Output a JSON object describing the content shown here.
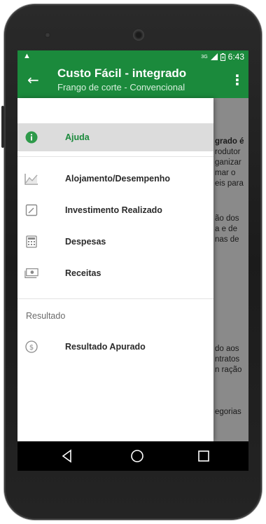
{
  "status_bar": {
    "alert_icon": "warning-icon",
    "network": "3G",
    "time": "6:43"
  },
  "app_bar": {
    "back_icon": "arrow-back-icon",
    "title": "Custo Fácil - integrado",
    "subtitle": "Frango de corte - Convencional",
    "menu_icon": "more-vert-icon"
  },
  "background_text": [
    "grado é",
    "rodutor",
    "ganizar",
    "mar o",
    "eis para",
    "ão dos",
    "a e de",
    "nas de",
    "do aos",
    "ntratos",
    "n ração",
    "egorias"
  ],
  "drawer": {
    "items": [
      {
        "label": "Ajuda",
        "icon": "info-icon"
      },
      {
        "label": "Alojamento/Desempenho",
        "icon": "chart-line-icon"
      },
      {
        "label": "Investimento Realizado",
        "icon": "edit-box-icon"
      },
      {
        "label": "Despesas",
        "icon": "calculator-icon"
      },
      {
        "label": "Receitas",
        "icon": "cash-icon"
      }
    ],
    "section_header": "Resultado",
    "result_item": {
      "label": "Resultado Apurado",
      "icon": "dollar-circle-icon"
    }
  },
  "colors": {
    "primary": "#1b8a3c",
    "active_bg": "#dcdcdc",
    "scrim": "#8a8a8a"
  },
  "nav_bar": {
    "back": "nav-back-icon",
    "home": "nav-home-icon",
    "recents": "nav-recents-icon"
  }
}
